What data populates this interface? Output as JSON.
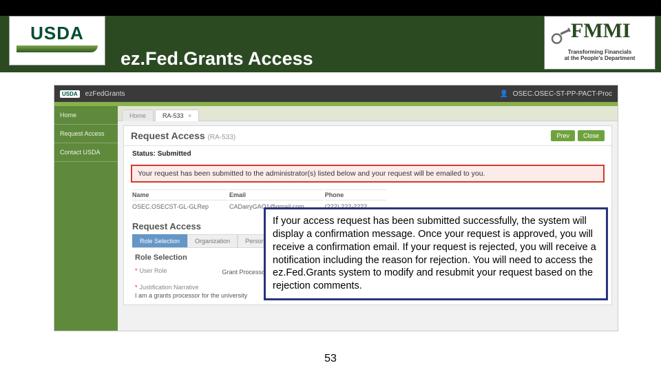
{
  "slide": {
    "title": "ez.Fed.Grants Access",
    "page_number": "53"
  },
  "logos": {
    "usda": "USDA",
    "fmmi": "FMMI",
    "fmmi_sub1": "Transforming Financials",
    "fmmi_sub2": "at the People's Department"
  },
  "app": {
    "brand": "ezFedGrants",
    "mini_usda": "USDA",
    "user_label": "OSEC.OSEC-ST-PP-PACT-Proc",
    "sidebar": {
      "items": [
        {
          "label": "Home"
        },
        {
          "label": "Request Access"
        },
        {
          "label": "Contact USDA"
        }
      ]
    },
    "tabs": [
      {
        "label": "Home",
        "active": false
      },
      {
        "label": "RA-533",
        "active": true,
        "close": "×"
      }
    ],
    "panel": {
      "title": "Request Access",
      "title_sub": "(RA-533)",
      "buttons": {
        "prev": "Prev",
        "close": "Close"
      }
    },
    "status": {
      "label": "Status:",
      "value": "Submitted"
    },
    "alert": "Your request has been submitted to the administrator(s) listed below and your request will be emailed to you.",
    "table": {
      "headers": {
        "name": "Name",
        "email": "Email",
        "phone": "Phone"
      },
      "row": {
        "name": "OSEC.OSECST-GL-GLRep",
        "email": "CADairyGAO1@gmail.com",
        "phone": "(222) 222-2222"
      }
    },
    "request_access": {
      "heading": "Request Access",
      "subtabs": {
        "role": "Role Selection",
        "org": "Organization",
        "personal": "Personal Information"
      },
      "section_title": "Role Selection",
      "user_role_label": "User Role",
      "user_role_value": "Grant Processor",
      "justification_label": "Justification Narrative",
      "justification_value": "I am a grants processor for the university"
    }
  },
  "callout": {
    "text": "If your access request has been submitted successfully, the system will display a confirmation message. Once your request is approved, you will receive a confirmation email. If your request is rejected, you will receive a notification including the reason for rejection. You will need to access the ez.Fed.Grants system to modify and resubmit your request based on the rejection comments."
  }
}
